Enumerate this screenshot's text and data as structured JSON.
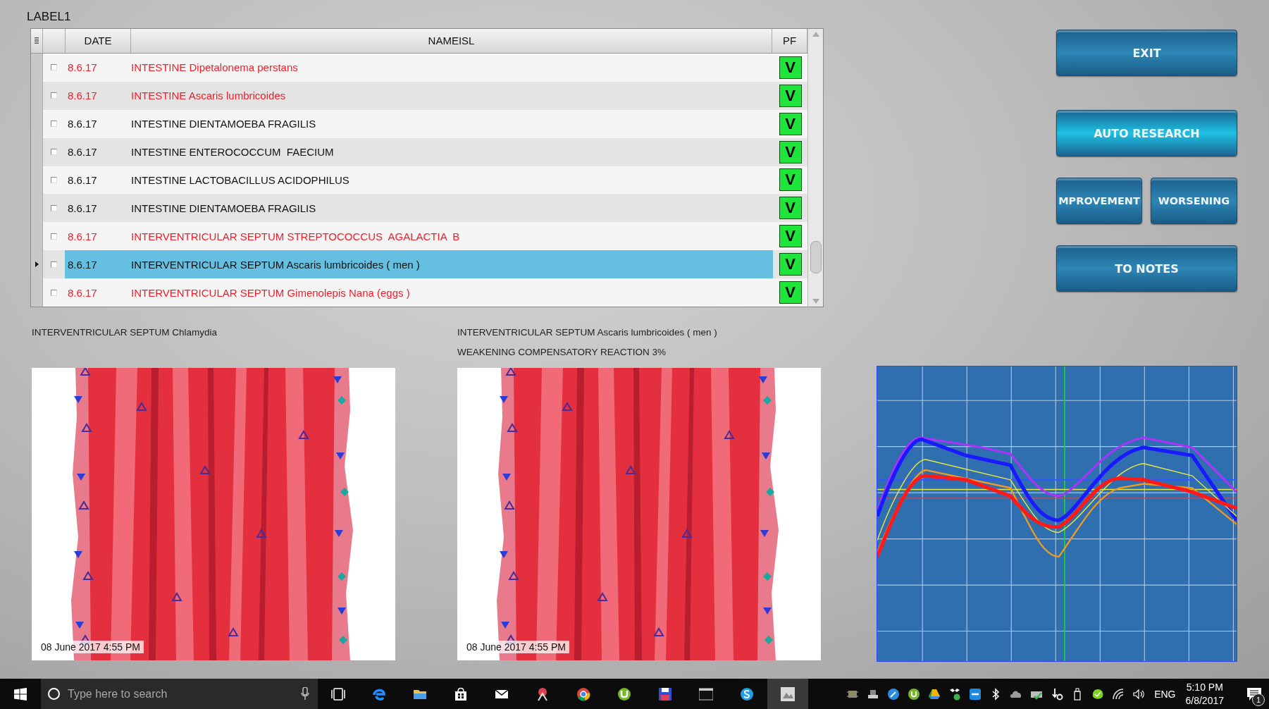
{
  "label": "LABEL1",
  "table": {
    "columns": [
      "DATE",
      "NAMEISL",
      "PF"
    ],
    "rows": [
      {
        "date": "8.6.17",
        "name": "INTESTINE Dipetalonema perstans",
        "pf": "V",
        "flagged": true,
        "checked": false,
        "selected": false
      },
      {
        "date": "8.6.17",
        "name": "INTESTINE Ascaris lumbricoides",
        "pf": "V",
        "flagged": true,
        "checked": false,
        "selected": false
      },
      {
        "date": "8.6.17",
        "name": "INTESTINE DIENTAMOEBA FRAGILIS",
        "pf": "V",
        "flagged": false,
        "checked": false,
        "selected": false
      },
      {
        "date": "8.6.17",
        "name": "INTESTINE ENTEROCOCCUM  FAECIUM",
        "pf": "V",
        "flagged": false,
        "checked": false,
        "selected": false
      },
      {
        "date": "8.6.17",
        "name": "INTESTINE LACTOBACILLUS ACIDOPHILUS",
        "pf": "V",
        "flagged": false,
        "checked": false,
        "selected": false
      },
      {
        "date": "8.6.17",
        "name": "INTESTINE DIENTAMOEBA FRAGILIS",
        "pf": "V",
        "flagged": false,
        "checked": false,
        "selected": false
      },
      {
        "date": "8.6.17",
        "name": "INTERVENTRICULAR SEPTUM STREPTOCOCCUS  AGALACTIA  B",
        "pf": "V",
        "flagged": true,
        "checked": false,
        "selected": false
      },
      {
        "date": "8.6.17",
        "name": "INTERVENTRICULAR SEPTUM Ascaris lumbricoides ( men )",
        "pf": "V",
        "flagged": false,
        "checked": false,
        "selected": true
      },
      {
        "date": "8.6.17",
        "name": "INTERVENTRICULAR SEPTUM Gimenolepis Nana (eggs )",
        "pf": "V",
        "flagged": true,
        "checked": false,
        "selected": false
      }
    ]
  },
  "buttons": [
    {
      "label": "EXIT",
      "kind": "wide"
    },
    {
      "label": "AUTO RESEARCH",
      "kind": "wide"
    },
    {
      "label": "MPROVEMENT",
      "kind": "half"
    },
    {
      "label": "WORSENING",
      "kind": "half"
    },
    {
      "label": "TO NOTES",
      "kind": "wide"
    }
  ],
  "panels": [
    {
      "captions": [
        "INTERVENTRICULAR SEPTUM Chlamydia"
      ],
      "image": {
        "kind": "picture",
        "timestamp": "08 June 2017 4:55 PM"
      }
    },
    {
      "captions": [
        "INTERVENTRICULAR SEPTUM Ascaris lumbricoides ( men )",
        "WEAKENING COMPENSATORY REACTION 3%"
      ],
      "image": {
        "kind": "picture",
        "timestamp": "08 June 2017 4:55 PM"
      }
    }
  ],
  "taskbar": {
    "search_placeholder": "Type here to search",
    "language": "ENG",
    "time": "5:10 PM",
    "date": "6/8/2017",
    "notifications": "1"
  }
}
